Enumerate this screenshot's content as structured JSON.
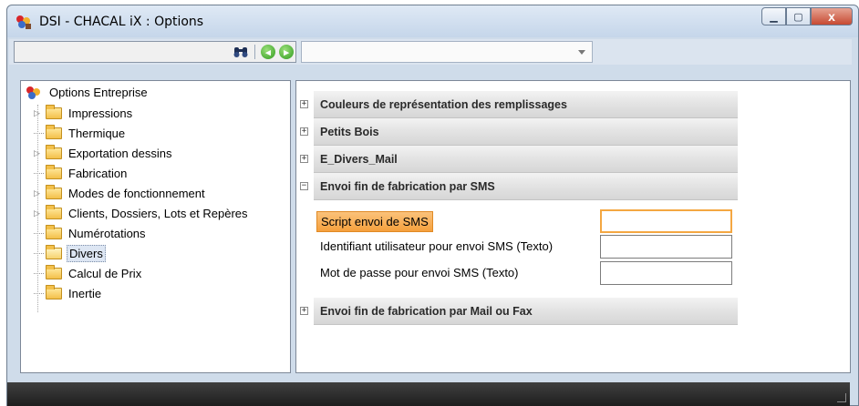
{
  "window": {
    "title": "DSI - CHACAL iX : Options",
    "minimize_icon": "minimize-icon",
    "maximize_icon": "maximize-icon",
    "close_icon": "close-icon",
    "close_glyph": "x"
  },
  "toolbar": {
    "search_value": "",
    "combo_value": "",
    "icons": [
      "binoculars-icon",
      "back-arrow-icon",
      "forward-arrow-icon",
      "chevron-down-icon"
    ]
  },
  "tree": {
    "root_label": "Options Entreprise",
    "items": [
      {
        "label": "Impressions",
        "expandable": true
      },
      {
        "label": "Thermique",
        "expandable": false
      },
      {
        "label": "Exportation dessins",
        "expandable": true
      },
      {
        "label": "Fabrication",
        "expandable": false
      },
      {
        "label": "Modes de fonctionnement",
        "expandable": true
      },
      {
        "label": "Clients, Dossiers, Lots et Repères",
        "expandable": true
      },
      {
        "label": "Numérotations",
        "expandable": false
      },
      {
        "label": "Divers",
        "expandable": false,
        "selected": true
      },
      {
        "label": "Calcul de Prix",
        "expandable": false
      },
      {
        "label": "Inertie",
        "expandable": false
      }
    ]
  },
  "sections": [
    {
      "title": "Couleurs de représentation des remplissages",
      "expanded": false,
      "toggle": "+"
    },
    {
      "title": "Petits Bois",
      "expanded": false,
      "toggle": "+"
    },
    {
      "title": "E_Divers_Mail",
      "expanded": false,
      "toggle": "+"
    },
    {
      "title": "Envoi fin de fabrication par SMS",
      "expanded": true,
      "toggle": "−"
    },
    {
      "title": "Envoi fin de fabrication par Mail ou Fax",
      "expanded": false,
      "toggle": "+"
    }
  ],
  "sms_fields": [
    {
      "label": "Script envoi de SMS",
      "value": "",
      "active": true
    },
    {
      "label": "Identifiant utilisateur pour envoi SMS (Texto)",
      "value": ""
    },
    {
      "label": "Mot de passe pour envoi SMS (Texto)",
      "value": ""
    }
  ],
  "colors": {
    "accent_orange": "#f5a03d",
    "window_frame": "#cfdcea",
    "section_header": "#e4e4e4"
  }
}
